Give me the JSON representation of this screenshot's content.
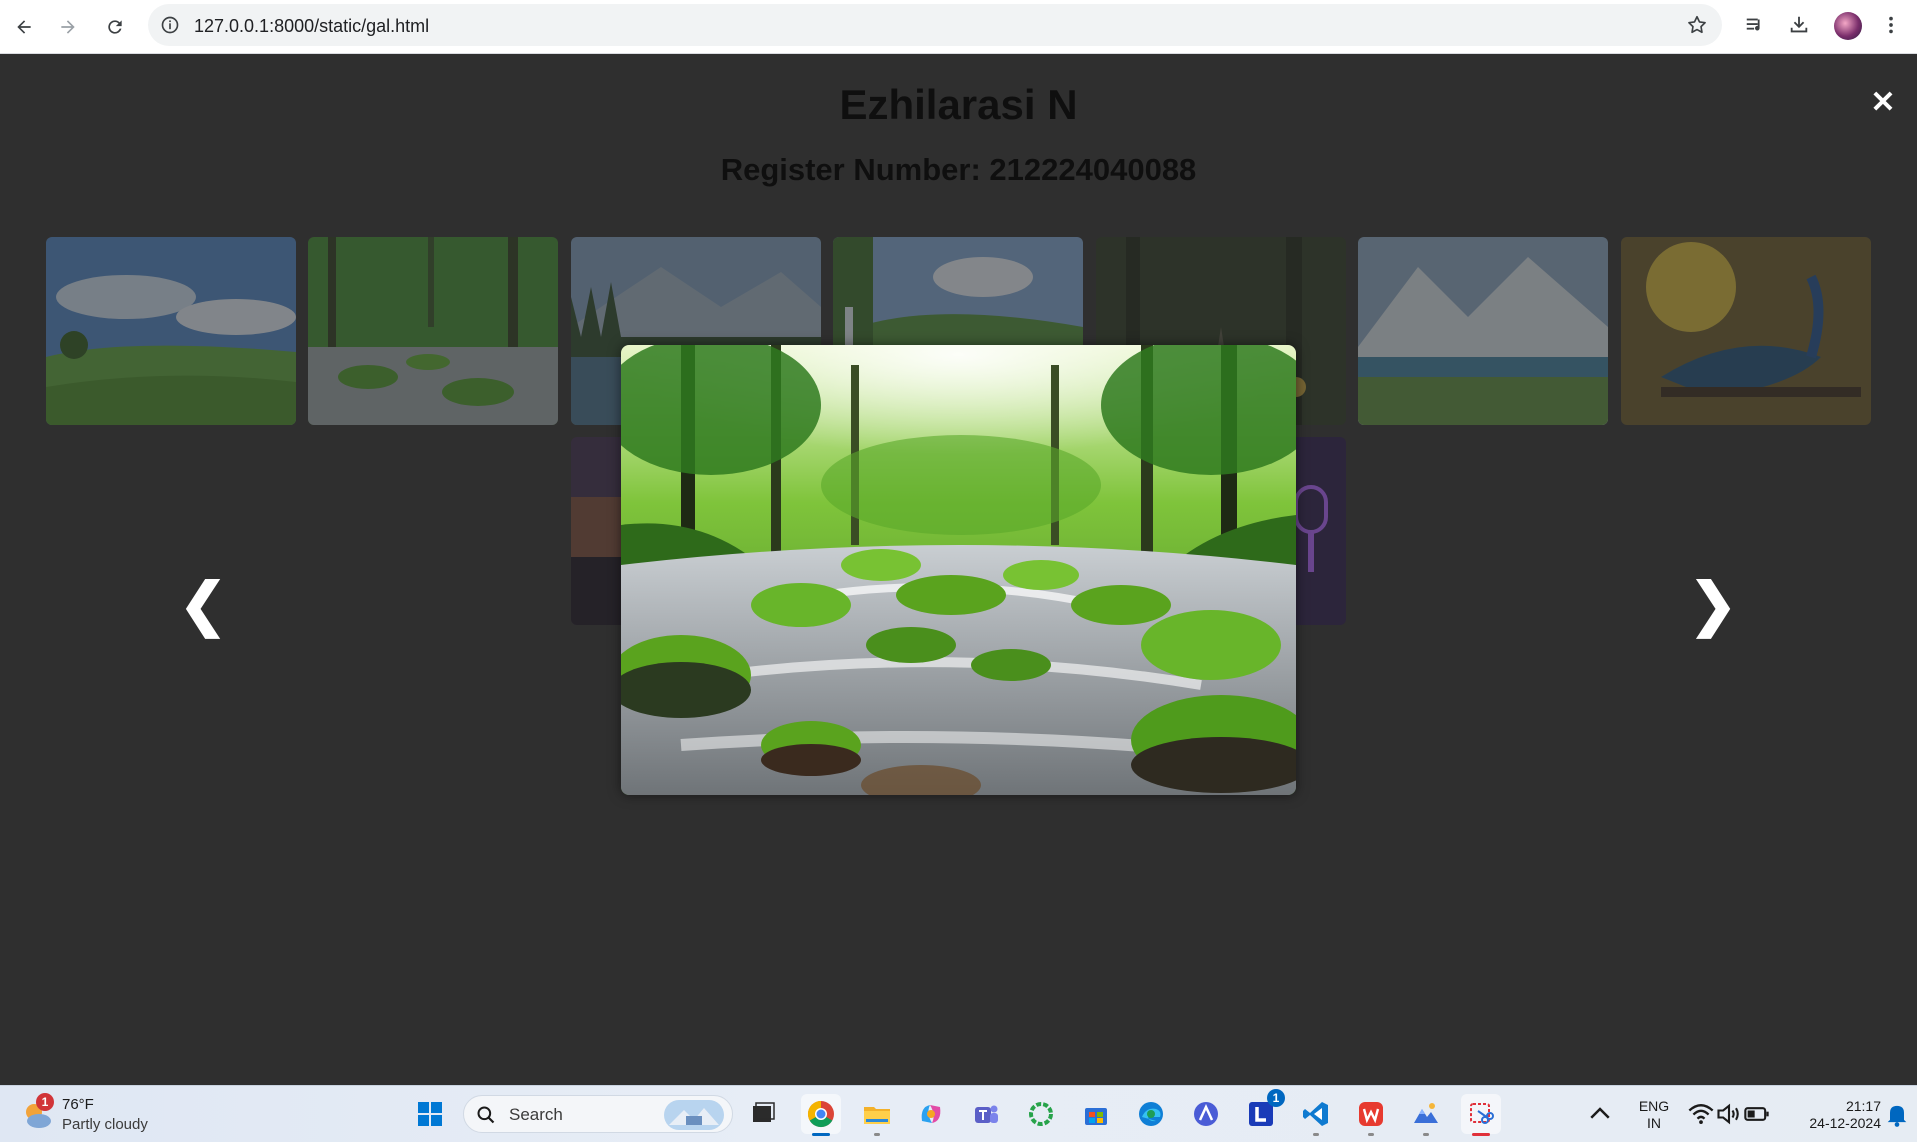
{
  "browser": {
    "url": "127.0.0.1:8000/static/gal.html"
  },
  "page": {
    "heading": "Ezhilarasi N",
    "subheading": "Register Number: 212224040088"
  },
  "gallery": {
    "thumbnails": [
      {
        "subject": "green meadow under blue sky"
      },
      {
        "subject": "forest stream with mossy rocks"
      },
      {
        "subject": "mountain lake with pine forest"
      },
      {
        "subject": "waterfall with green hills"
      },
      {
        "subject": "dark forest path"
      },
      {
        "subject": "snowy mountains and lake"
      },
      {
        "subject": "peacock on branch"
      },
      {
        "subject": "sunset sky"
      },
      {
        "subject": "neon microphone"
      }
    ]
  },
  "lightbox": {
    "close_label": "✕",
    "prev_label": "❮",
    "next_label": "❯",
    "image_subject": "forest stream with mossy rocks"
  },
  "taskbar": {
    "weather": {
      "temperature": "76°F",
      "condition": "Partly cloudy",
      "alert_count": "1"
    },
    "search_placeholder": "Search",
    "teams_badge": "1",
    "language": {
      "line1": "ENG",
      "line2": "IN"
    },
    "clock": {
      "time": "21:17",
      "date": "24-12-2024"
    }
  }
}
